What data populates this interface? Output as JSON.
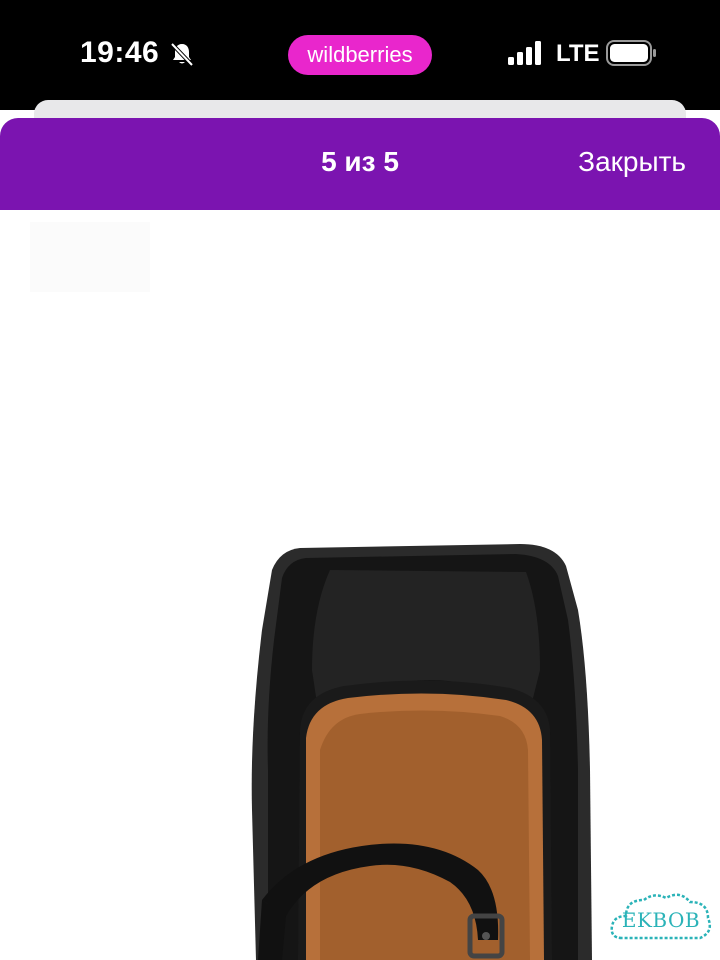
{
  "status_bar": {
    "time": "19:46",
    "app_name": "wildberries",
    "network": "LTE",
    "icons": [
      "bell-muted-icon",
      "signal-icon",
      "battery-icon"
    ]
  },
  "viewer": {
    "counter": "5 из 5",
    "close_label": "Закрыть",
    "header_color": "#7b14b0"
  },
  "photo": {
    "subject": "shoe-photo",
    "background": "#ffffff"
  },
  "watermark": {
    "text": "EKBOB"
  },
  "colors": {
    "app_pill": "#e926cc",
    "header": "#7b14b0",
    "watermark": "#2bb3b8"
  }
}
